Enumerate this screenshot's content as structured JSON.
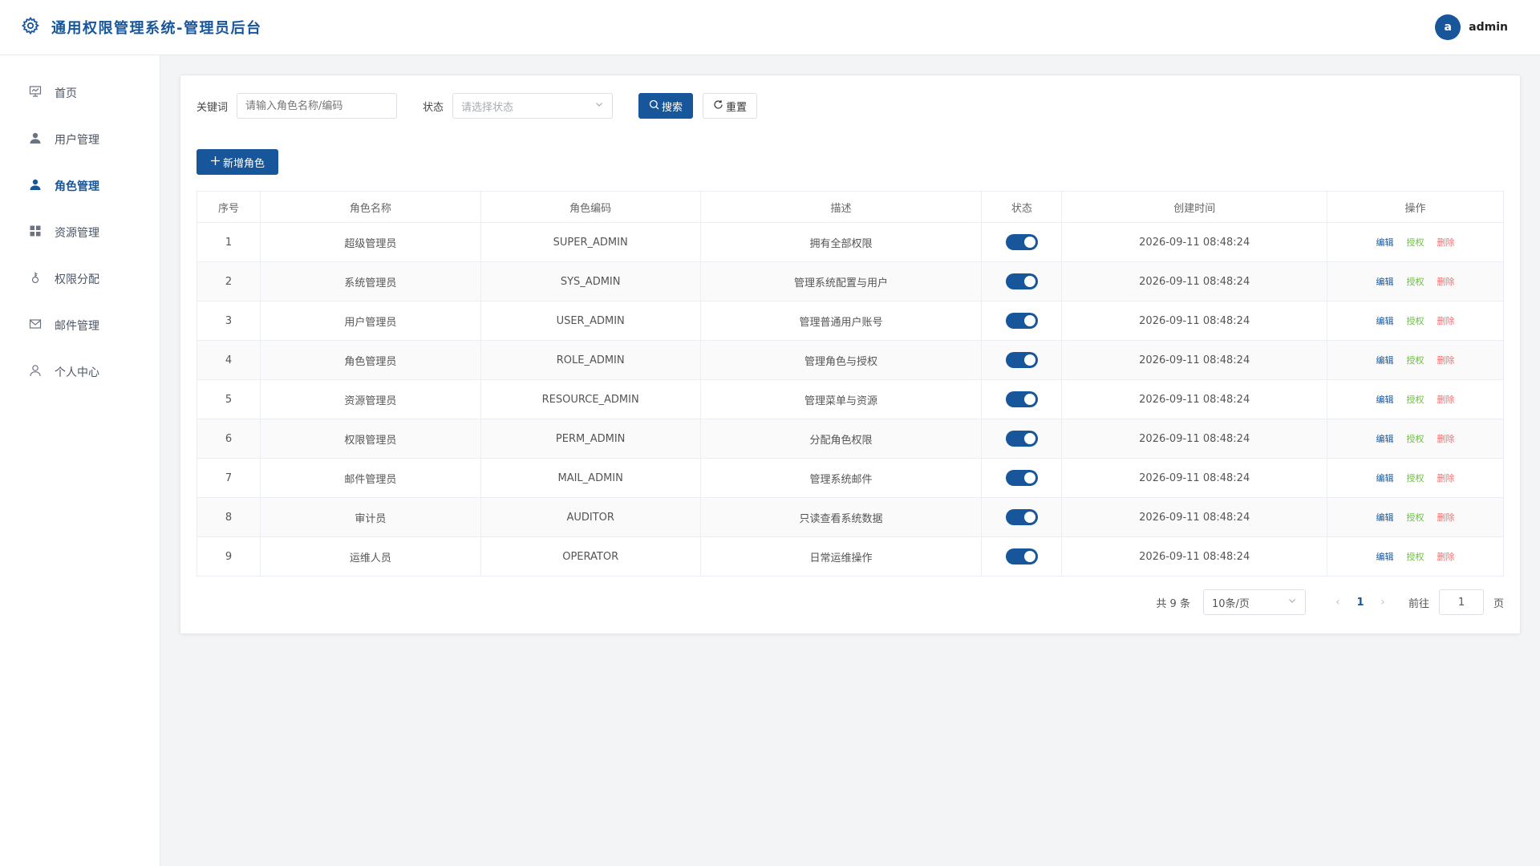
{
  "header": {
    "title": "通用权限管理系统-管理员后台",
    "avatar_letter": "a",
    "username": "admin"
  },
  "sidebar": {
    "items": [
      {
        "label": "首页",
        "icon": "dashboard-icon",
        "active": false
      },
      {
        "label": "用户管理",
        "icon": "user-icon",
        "active": false
      },
      {
        "label": "角色管理",
        "icon": "user-icon",
        "active": true
      },
      {
        "label": "资源管理",
        "icon": "grid-icon",
        "active": false
      },
      {
        "label": "权限分配",
        "icon": "key-icon",
        "active": false
      },
      {
        "label": "邮件管理",
        "icon": "mail-icon",
        "active": false
      },
      {
        "label": "个人中心",
        "icon": "person-outline-icon",
        "active": false
      }
    ]
  },
  "filters": {
    "keyword_label": "关键词",
    "keyword_placeholder": "请输入角色名称/编码",
    "status_label": "状态",
    "status_placeholder": "请选择状态",
    "search_label": "搜索",
    "reset_label": "重置"
  },
  "toolbar": {
    "add_label": "新增角色"
  },
  "table": {
    "columns": [
      "序号",
      "角色名称",
      "角色编码",
      "描述",
      "状态",
      "创建时间",
      "操作"
    ],
    "actions": {
      "edit": "编辑",
      "grant": "授权",
      "delete": "删除"
    },
    "rows": [
      {
        "no": "1",
        "name": "超级管理员",
        "code": "SUPER_ADMIN",
        "desc": "拥有全部权限",
        "enabled": true,
        "created": "2026-09-11 08:48:24"
      },
      {
        "no": "2",
        "name": "系统管理员",
        "code": "SYS_ADMIN",
        "desc": "管理系统配置与用户",
        "enabled": true,
        "created": "2026-09-11 08:48:24"
      },
      {
        "no": "3",
        "name": "用户管理员",
        "code": "USER_ADMIN",
        "desc": "管理普通用户账号",
        "enabled": true,
        "created": "2026-09-11 08:48:24"
      },
      {
        "no": "4",
        "name": "角色管理员",
        "code": "ROLE_ADMIN",
        "desc": "管理角色与授权",
        "enabled": true,
        "created": "2026-09-11 08:48:24"
      },
      {
        "no": "5",
        "name": "资源管理员",
        "code": "RESOURCE_ADMIN",
        "desc": "管理菜单与资源",
        "enabled": true,
        "created": "2026-09-11 08:48:24"
      },
      {
        "no": "6",
        "name": "权限管理员",
        "code": "PERM_ADMIN",
        "desc": "分配角色权限",
        "enabled": true,
        "created": "2026-09-11 08:48:24"
      },
      {
        "no": "7",
        "name": "邮件管理员",
        "code": "MAIL_ADMIN",
        "desc": "管理系统邮件",
        "enabled": true,
        "created": "2026-09-11 08:48:24"
      },
      {
        "no": "8",
        "name": "审计员",
        "code": "AUDITOR",
        "desc": "只读查看系统数据",
        "enabled": true,
        "created": "2026-09-11 08:48:24"
      },
      {
        "no": "9",
        "name": "运维人员",
        "code": "OPERATOR",
        "desc": "日常运维操作",
        "enabled": true,
        "created": "2026-09-11 08:48:24"
      }
    ]
  },
  "pagination": {
    "total_text": "共 9 条",
    "page_size": "10条/页",
    "current_page": "1",
    "goto_label": "前往",
    "goto_value": "1",
    "page_suffix": "页"
  },
  "colors": {
    "primary": "#17569a",
    "grant": "#67c23a",
    "delete": "#f56c6c"
  }
}
